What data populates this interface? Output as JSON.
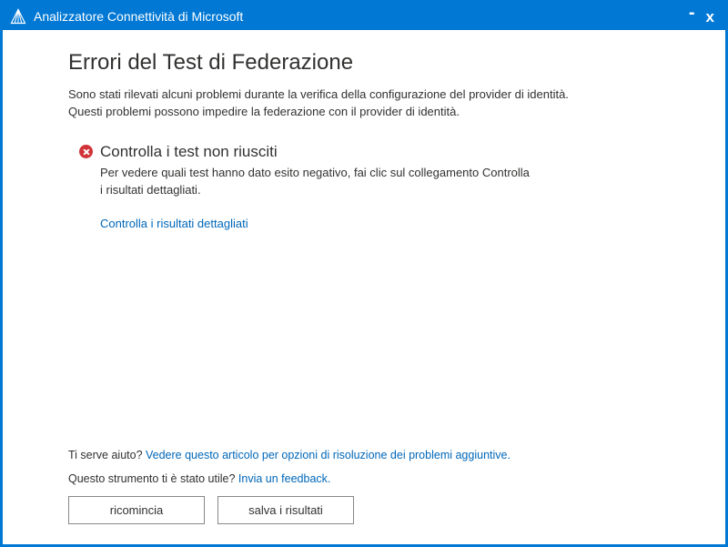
{
  "window": {
    "title": "Analizzatore Connettività di Microsoft"
  },
  "page": {
    "title": "Errori del Test di Federazione",
    "description_line1": "Sono stati rilevati alcuni problemi durante la verifica della configurazione del provider di identità.",
    "description_line2": "Questi problemi possono impedire la federazione con il provider di identità."
  },
  "section": {
    "title": "Controlla i test non riusciti",
    "body_line1": "Per vedere quali test hanno dato esito negativo, fai clic sul collegamento Controlla",
    "body_line2": "i risultati dettagliati.",
    "details_link": "Controlla i risultati dettagliati"
  },
  "help": {
    "prefix": "Ti serve aiuto? ",
    "link": "Vedere questo articolo per opzioni di risoluzione dei problemi aggiuntive."
  },
  "feedback": {
    "prefix": "Questo strumento ti è stato utile? ",
    "link": "Invia un feedback."
  },
  "buttons": {
    "restart": "ricomincia",
    "save": "salva i risultati"
  }
}
